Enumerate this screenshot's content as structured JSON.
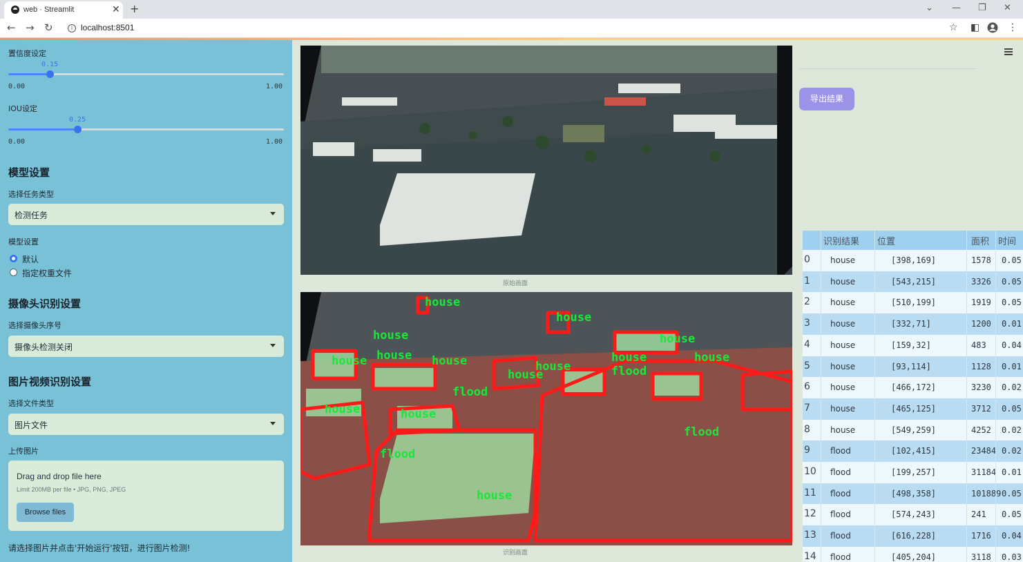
{
  "browser": {
    "tab_title": "web · Streamlit",
    "url": "localhost:8501"
  },
  "sidebar": {
    "conf_label": "置信度设定",
    "conf_value": "0.15",
    "conf_fraction": 0.15,
    "conf_min": "0.00",
    "conf_max": "1.00",
    "iou_label": "IOU设定",
    "iou_value": "0.25",
    "iou_fraction": 0.25,
    "iou_min": "0.00",
    "iou_max": "1.00",
    "model_section": "模型设置",
    "task_label": "选择任务类型",
    "task_value": "检测任务",
    "model_label": "模型设置",
    "radio_default": "默认",
    "radio_custom": "指定权重文件",
    "camera_section": "摄像头识别设置",
    "camera_label": "选择摄像头序号",
    "camera_value": "摄像头检测关闭",
    "media_section": "图片视频识别设置",
    "file_type_label": "选择文件类型",
    "file_type_value": "图片文件",
    "upload_label": "上传图片",
    "drop_title": "Drag and drop file here",
    "drop_limit": "Limit 200MB per file • JPG, PNG, JPEG",
    "browse_label": "Browse files",
    "hint": "请选择图片并点击'开始运行'按钮，进行图片检测!"
  },
  "main": {
    "original_caption": "原始画面",
    "result_caption": "识别画面",
    "export_label": "导出结果"
  },
  "table": {
    "headers": [
      "识别结果",
      "位置",
      "面积",
      "时间"
    ],
    "rows": [
      {
        "idx": "0",
        "cls": "house",
        "pos": "[398,169]",
        "area": "1578",
        "time": "0.05"
      },
      {
        "idx": "1",
        "cls": "house",
        "pos": "[543,215]",
        "area": "3326",
        "time": "0.05"
      },
      {
        "idx": "2",
        "cls": "house",
        "pos": "[510,199]",
        "area": "1919",
        "time": "0.05"
      },
      {
        "idx": "3",
        "cls": "house",
        "pos": "[332,71]",
        "area": "1200",
        "time": "0.01"
      },
      {
        "idx": "4",
        "cls": "house",
        "pos": "[159,32]",
        "area": "483",
        "time": "0.04"
      },
      {
        "idx": "5",
        "cls": "house",
        "pos": "[93,114]",
        "area": "1128",
        "time": "0.01"
      },
      {
        "idx": "6",
        "cls": "house",
        "pos": "[466,172]",
        "area": "3230",
        "time": "0.02"
      },
      {
        "idx": "7",
        "cls": "house",
        "pos": "[465,125]",
        "area": "3712",
        "time": "0.05"
      },
      {
        "idx": "8",
        "cls": "house",
        "pos": "[549,259]",
        "area": "4252",
        "time": "0.02"
      },
      {
        "idx": "9",
        "cls": "flood",
        "pos": "[102,415]",
        "area": "23484",
        "time": "0.02"
      },
      {
        "idx": "10",
        "cls": "flood",
        "pos": "[199,257]",
        "area": "31184",
        "time": "0.01"
      },
      {
        "idx": "11",
        "cls": "flood",
        "pos": "[498,358]",
        "area": "101889",
        "time": "0.05"
      },
      {
        "idx": "12",
        "cls": "flood",
        "pos": "[574,243]",
        "area": "241",
        "time": "0.05"
      },
      {
        "idx": "13",
        "cls": "flood",
        "pos": "[616,228]",
        "area": "1716",
        "time": "0.04"
      },
      {
        "idx": "14",
        "cls": "flood",
        "pos": "[405,204]",
        "area": "3118",
        "time": "0.03"
      }
    ]
  },
  "detections": {
    "labels": [
      "house",
      "house",
      "house",
      "house",
      "house",
      "house",
      "house",
      "house",
      "house",
      "house",
      "house",
      "house",
      "house",
      "house",
      "flood",
      "flood",
      "flood",
      "flood"
    ],
    "box_color": "#ff1a1a",
    "label_color": "#17e83a"
  },
  "colors": {
    "sidebar_bg": "#78c1d6",
    "main_bg": "#dde8da",
    "accent": "#3a73f0",
    "export_btn": "#9b93e8"
  }
}
